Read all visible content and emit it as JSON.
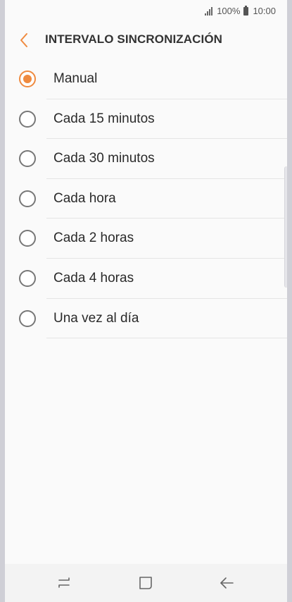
{
  "status_bar": {
    "battery": "100%",
    "time": "10:00"
  },
  "header": {
    "back_icon": "chevron-left-icon",
    "title": "INTERVALO SINCRONIZACIÓN"
  },
  "accent_color": "#ef8a3f",
  "options": [
    {
      "label": "Manual",
      "selected": true
    },
    {
      "label": "Cada 15 minutos",
      "selected": false
    },
    {
      "label": "Cada 30 minutos",
      "selected": false
    },
    {
      "label": "Cada hora",
      "selected": false
    },
    {
      "label": "Cada 2 horas",
      "selected": false
    },
    {
      "label": "Cada 4 horas",
      "selected": false
    },
    {
      "label": "Una vez al día",
      "selected": false
    }
  ],
  "nav_bar": {
    "recents_icon": "recent-apps-icon",
    "home_icon": "home-icon",
    "back_icon": "back-arrow-icon"
  }
}
